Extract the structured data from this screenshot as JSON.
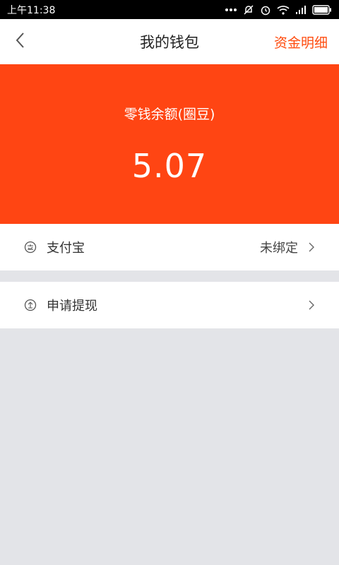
{
  "status_bar": {
    "time": "上午11:38"
  },
  "nav": {
    "title": "我的钱包",
    "action": "资金明细"
  },
  "balance": {
    "label": "零钱余额(圈豆)",
    "value": "5.07"
  },
  "rows": [
    {
      "label": "支付宝",
      "value": "未绑定",
      "icon": "alipay-icon"
    },
    {
      "label": "申请提现",
      "value": "",
      "icon": "withdraw-icon"
    }
  ],
  "colors": {
    "accent": "#ff4513",
    "action_text": "#ff4c0f",
    "background": "#e3e4e8"
  }
}
